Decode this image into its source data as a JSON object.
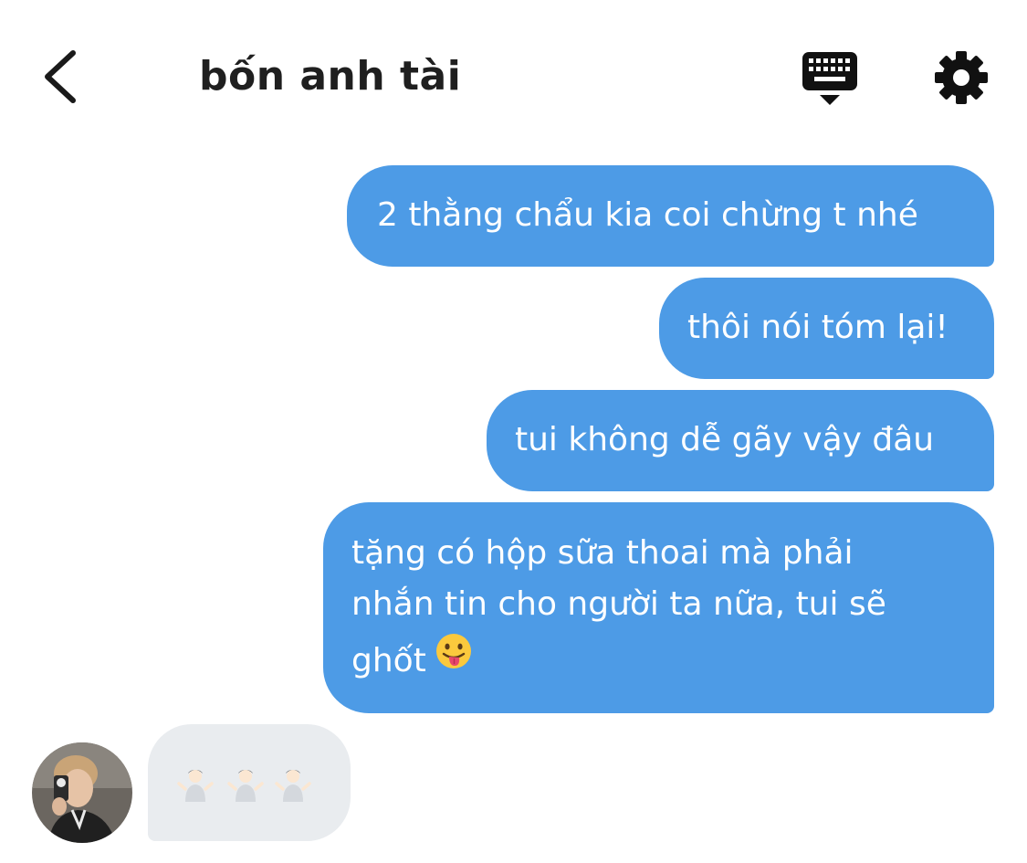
{
  "header": {
    "title": "bốn anh tài",
    "back_icon": "chevron-left-icon",
    "keyboard_icon": "keyboard-hide-icon",
    "settings_icon": "gear-icon"
  },
  "messages": {
    "outgoing": [
      {
        "text": "2 thằng chẩu kia coi chừng t nhé"
      },
      {
        "text": "thôi nói tóm lại!"
      },
      {
        "text": "tui không dễ gãy vậy đâu"
      },
      {
        "lines": [
          "tặng có hộp sữa thoai mà phải",
          "nhắn tin cho người ta nữa, tui sẽ",
          "ghốt"
        ],
        "emoji": "face-with-tongue-emoji"
      }
    ],
    "incoming": [
      {
        "emojis": [
          "person-shrugging-emoji",
          "person-shrugging-emoji",
          "person-shrugging-emoji"
        ]
      }
    ]
  },
  "colors": {
    "outgoing_bubble": "#4d9be6",
    "incoming_bubble": "#e9ecef",
    "title_text": "#1f1f1f"
  }
}
